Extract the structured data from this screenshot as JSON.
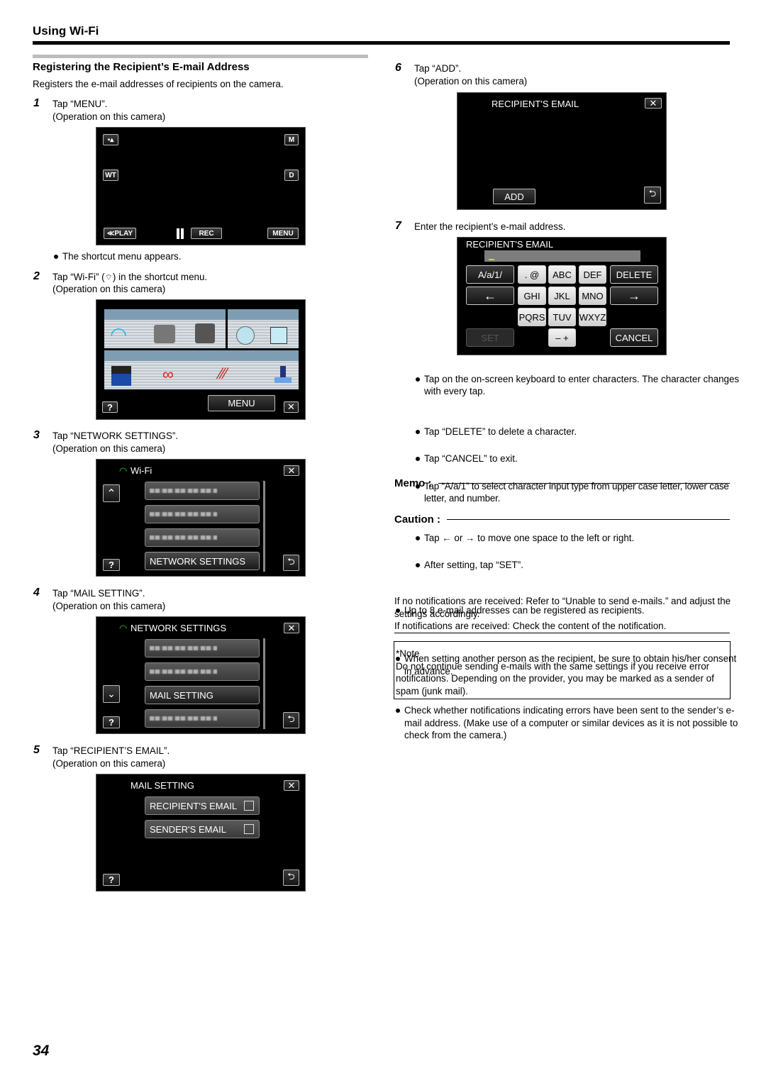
{
  "header": {
    "title": "Using Wi-Fi"
  },
  "section": {
    "title": "Registering the Recipient’s E-mail Address",
    "intro": "Registers the e-mail addresses of recipients on the camera."
  },
  "steps": [
    {
      "num": "1",
      "text": "Tap “MENU”.",
      "sub": "(Operation on this camera)"
    },
    {
      "num": "2",
      "text_before": "Tap “Wi-Fi” (",
      "text_after": ") in the shortcut menu.",
      "sub": "(Operation on this camera)"
    },
    {
      "num": "3",
      "text": "Tap “NETWORK SETTINGS”.",
      "sub": "(Operation on this camera)"
    },
    {
      "num": "4",
      "text": "Tap “MAIL SETTING”.",
      "sub": "(Operation on this camera)"
    },
    {
      "num": "5",
      "text": "Tap “RECIPIENT’S EMAIL”.",
      "sub": "(Operation on this camera)"
    },
    {
      "num": "6",
      "text": "Tap “ADD”.",
      "sub": "(Operation on this camera)"
    },
    {
      "num": "7",
      "text": "Enter the recipient’s e-mail address."
    }
  ],
  "step1_note": "The shortcut menu appears.",
  "screen1": {
    "icon_top_left": "movie-mode",
    "m": "M",
    "wt": "WT",
    "d": "D",
    "play": "≪PLAY",
    "rec": "REC",
    "menu": "MENU"
  },
  "screen2": {
    "menu": "MENU",
    "help": "?",
    "close": "✕"
  },
  "screen3": {
    "title": "Wi-Fi",
    "selected": "NETWORK SETTINGS",
    "help": "?"
  },
  "screen4": {
    "title": "NETWORK SETTINGS",
    "selected": "MAIL SETTING",
    "help": "?"
  },
  "screen5": {
    "title": "MAIL SETTING",
    "items": [
      "RECIPIENT'S EMAIL",
      "SENDER'S EMAIL"
    ],
    "help": "?"
  },
  "screen6": {
    "title": "RECIPIENT'S EMAIL",
    "add": "ADD"
  },
  "screen7": {
    "title": "RECIPIENT'S EMAIL",
    "input_value": "",
    "keys": {
      "mode": "A/a/1/",
      "dot_at": ". @",
      "abc": "ABC",
      "def": "DEF",
      "delete": "DELETE",
      "left": "←",
      "ghi": "GHI",
      "jkl": "JKL",
      "mno": "MNO",
      "right": "→",
      "pqrs": "PQRS",
      "tuv": "TUV",
      "wxyz": "WXYZ",
      "set": "SET",
      "minus_plus": "– +",
      "cancel": "CANCEL"
    }
  },
  "step7_bullets": [
    "Tap on the on-screen keyboard to enter characters. The character changes with every tap.",
    "Tap “DELETE” to delete a character.",
    "Tap “CANCEL” to exit.",
    "Tap “A/a/1” to select character input type from upper case letter, lower case letter, and number.",
    "Tap ← or → to move one space to the left or right.",
    "After setting, tap “SET”."
  ],
  "memo": {
    "title": "Memo :",
    "items": [
      "Up to 8 e-mail addresses can be registered as recipients."
    ]
  },
  "caution": {
    "title": "Caution :",
    "items": [
      "When setting another person as the recipient, be sure to obtain his/her consent in advance.",
      "Check whether notifications indicating errors have been sent to the sender’s e-mail address. (Make use of a computer or similar devices as it is not possible to check from the camera.)"
    ],
    "para1": "If no notifications are received: Refer to “Unable to send e-mails.” and adjust the settings accordingly.",
    "para2": "If notifications are received: Check the content of the notification."
  },
  "note": {
    "title": "*Note",
    "text": "Do not continue sending e-mails with the same settings if you receive error notifications. Depending on the provider, you may be marked as a sender of spam (junk mail)."
  },
  "page_number": "34",
  "colors": {
    "wifi_green": "#37c838",
    "wifi_blue": "#1fb8e8",
    "screen_bg": "#000000",
    "input_cursor": "#d8d800"
  }
}
